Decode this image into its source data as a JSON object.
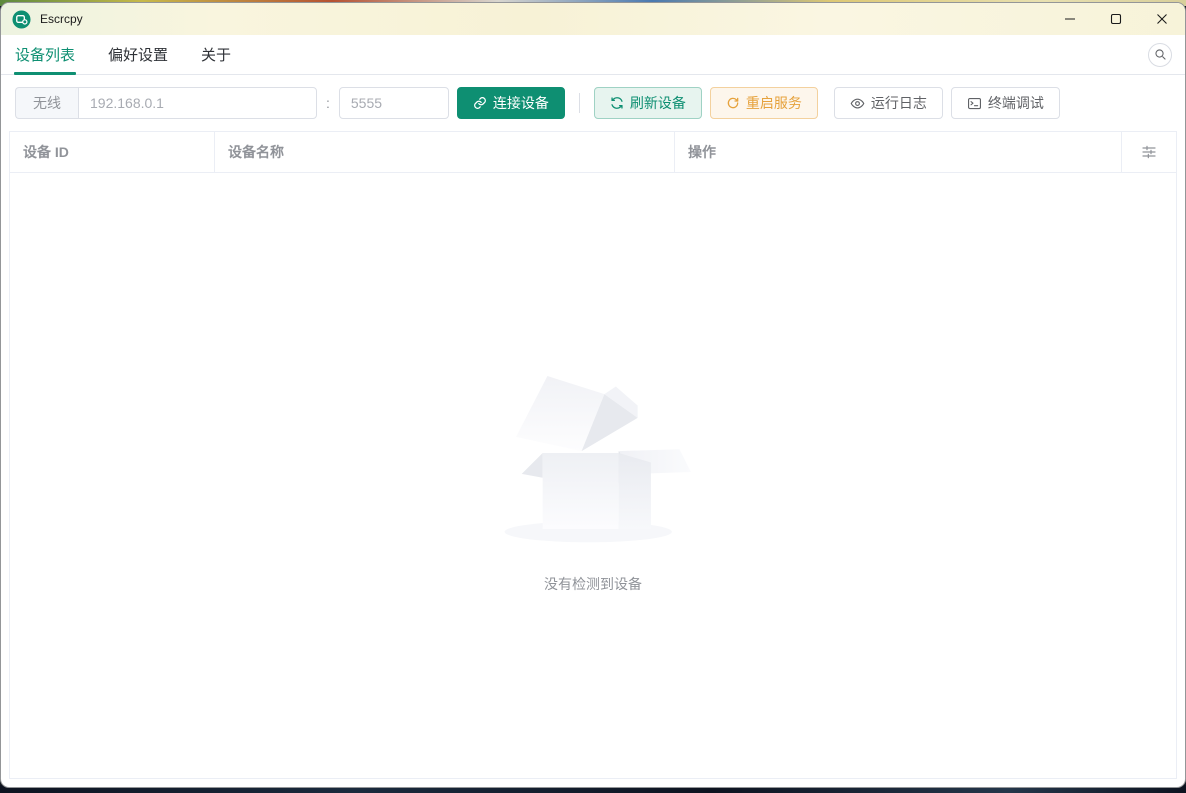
{
  "window": {
    "title": "Escrcpy",
    "controls": [
      "minimize",
      "maximize",
      "close"
    ]
  },
  "tabs": [
    {
      "label": "设备列表",
      "active": true
    },
    {
      "label": "偏好设置",
      "active": false
    },
    {
      "label": "关于",
      "active": false
    }
  ],
  "toolbar": {
    "wireless_label": "无线",
    "ip_placeholder": "192.168.0.1",
    "ip_value": "",
    "port_separator": ":",
    "port_placeholder": "5555",
    "port_value": "",
    "connect_label": "连接设备",
    "refresh_label": "刷新设备",
    "restart_label": "重启服务",
    "logs_label": "运行日志",
    "terminal_label": "终端调试"
  },
  "table": {
    "columns": [
      "设备 ID",
      "设备名称",
      "操作"
    ],
    "rows": [],
    "empty_text": "没有检测到设备"
  },
  "icons": {
    "app": "escrcpy-logo",
    "search": "magnifier",
    "connect": "link",
    "refresh": "refresh-arrows",
    "restart": "refresh-right",
    "logs": "eye",
    "terminal": "terminal-window",
    "column_settings": "sliders"
  },
  "colors": {
    "primary_teal": "#0e8f72",
    "success_plain_bg": "#e7f4ef",
    "warning_orange": "#e6a23c",
    "warning_plain_bg": "#fdf6ec",
    "titlebar_cream": "#f7f2d6",
    "table_border": "#ebeef5",
    "muted_text": "#909399",
    "placeholder_text": "#a8abb2"
  }
}
